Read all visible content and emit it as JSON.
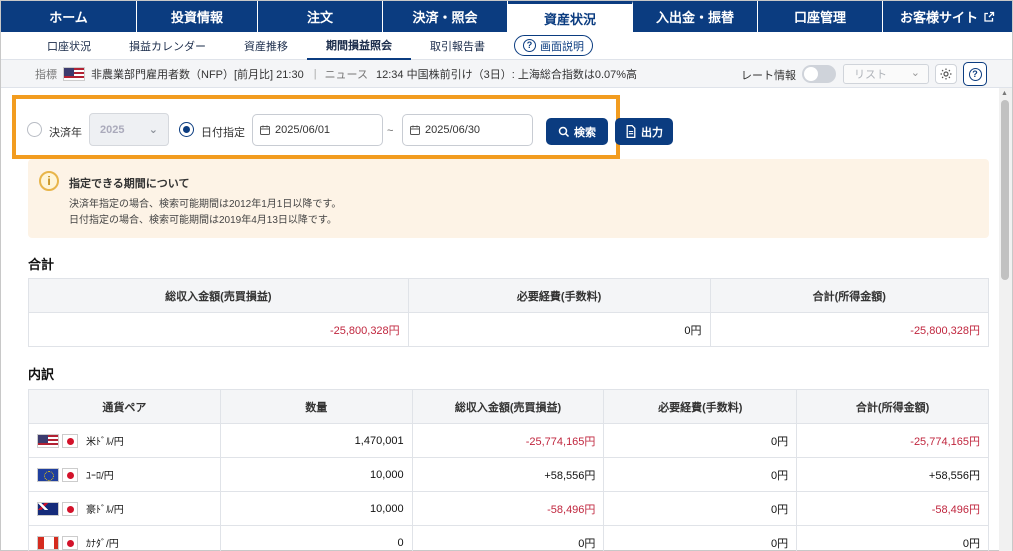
{
  "nav": {
    "items": [
      {
        "label": "ホーム",
        "width": 136
      },
      {
        "label": "投資情報",
        "width": 121
      },
      {
        "label": "注文",
        "width": 125
      },
      {
        "label": "決済・照会",
        "width": 125
      },
      {
        "label": "資産状況",
        "width": 125
      },
      {
        "label": "入出金・振替",
        "width": 125
      },
      {
        "label": "口座管理",
        "width": 125
      },
      {
        "label": "お客様サイト",
        "width": 129
      }
    ],
    "active": "資産状況",
    "external_icon": "external-link-icon"
  },
  "subnav": {
    "items": [
      "口座状況",
      "損益カレンダー",
      "資産推移",
      "期間損益照会",
      "取引報告書"
    ],
    "active": "期間損益照会",
    "help_label": "画面説明"
  },
  "ticker": {
    "indicator_label": "指標",
    "indicator_text": "非農業部門雇用者数（NFP）[前月比] 21:30",
    "news_label": "ニュース",
    "news_text": "12:34 中国株前引け（3日）: 上海総合指数は0.07%高",
    "rate_label": "レート情報",
    "list_label": "リスト"
  },
  "search": {
    "year_label": "決済年",
    "year_value": "2025",
    "date_label": "日付指定",
    "from_date": "2025/06/01",
    "to_date": "2025/06/30",
    "tilde": "~",
    "search_button": "検索",
    "export_button": "出力",
    "mode": "date"
  },
  "notice": {
    "title": "指定できる期間について",
    "line1": "決済年指定の場合、検索可能期間は2012年1月1日以降です。",
    "line2": "日付指定の場合、検索可能期間は2019年4月13日以降です。"
  },
  "totals": {
    "section_title": "合計",
    "headers": [
      "総収入金額(売買損益)",
      "必要経費(手数料)",
      "合計(所得金額)"
    ],
    "values": [
      "-25,800,328円",
      "0円",
      "-25,800,328円"
    ]
  },
  "breakdown": {
    "section_title": "内訳",
    "headers": [
      "通貨ペア",
      "数量",
      "総収入金額(売買損益)",
      "必要経費(手数料)",
      "合計(所得金額)"
    ],
    "rows": [
      {
        "flag": "us",
        "pair": "米ﾄﾞﾙ/円",
        "qty": "1,470,001",
        "income": "-25,774,165円",
        "fee": "0円",
        "total": "-25,774,165円",
        "neg": true
      },
      {
        "flag": "eu",
        "pair": "ﾕｰﾛ/円",
        "qty": "10,000",
        "income": "+58,556円",
        "fee": "0円",
        "total": "+58,556円",
        "neg": false
      },
      {
        "flag": "au",
        "pair": "豪ﾄﾞﾙ/円",
        "qty": "10,000",
        "income": "-58,496円",
        "fee": "0円",
        "total": "-58,496円",
        "neg": true
      },
      {
        "flag": "ca",
        "pair": "ｶﾅﾀﾞ/円",
        "qty": "0",
        "income": "0円",
        "fee": "0円",
        "total": "0円",
        "neg": false
      }
    ]
  },
  "colors": {
    "brand": "#0b3c80",
    "highlight": "#f29c1f",
    "negative": "#c0263e"
  }
}
